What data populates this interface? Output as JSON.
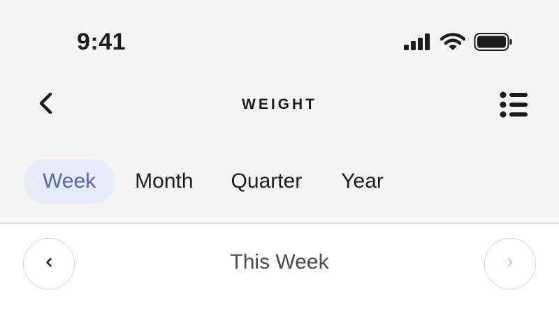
{
  "status_bar": {
    "time": "9:41",
    "icons": [
      "signal-icon",
      "wifi-icon",
      "battery-icon"
    ]
  },
  "nav": {
    "title": "WEIGHT",
    "back_icon": "chevron-left-icon",
    "menu_icon": "list-icon"
  },
  "tabs": [
    {
      "label": "Week",
      "active": true
    },
    {
      "label": "Month",
      "active": false
    },
    {
      "label": "Quarter",
      "active": false
    },
    {
      "label": "Year",
      "active": false
    }
  ],
  "period": {
    "label": "This Week",
    "prev_icon": "chevron-left-icon",
    "next_icon": "chevron-right-icon",
    "next_enabled": false
  },
  "colors": {
    "top_background": "#f5f4f2",
    "active_tab_background": "#e8ebfa",
    "active_tab_text": "#5566b8",
    "divider": "#dcdcdc"
  }
}
